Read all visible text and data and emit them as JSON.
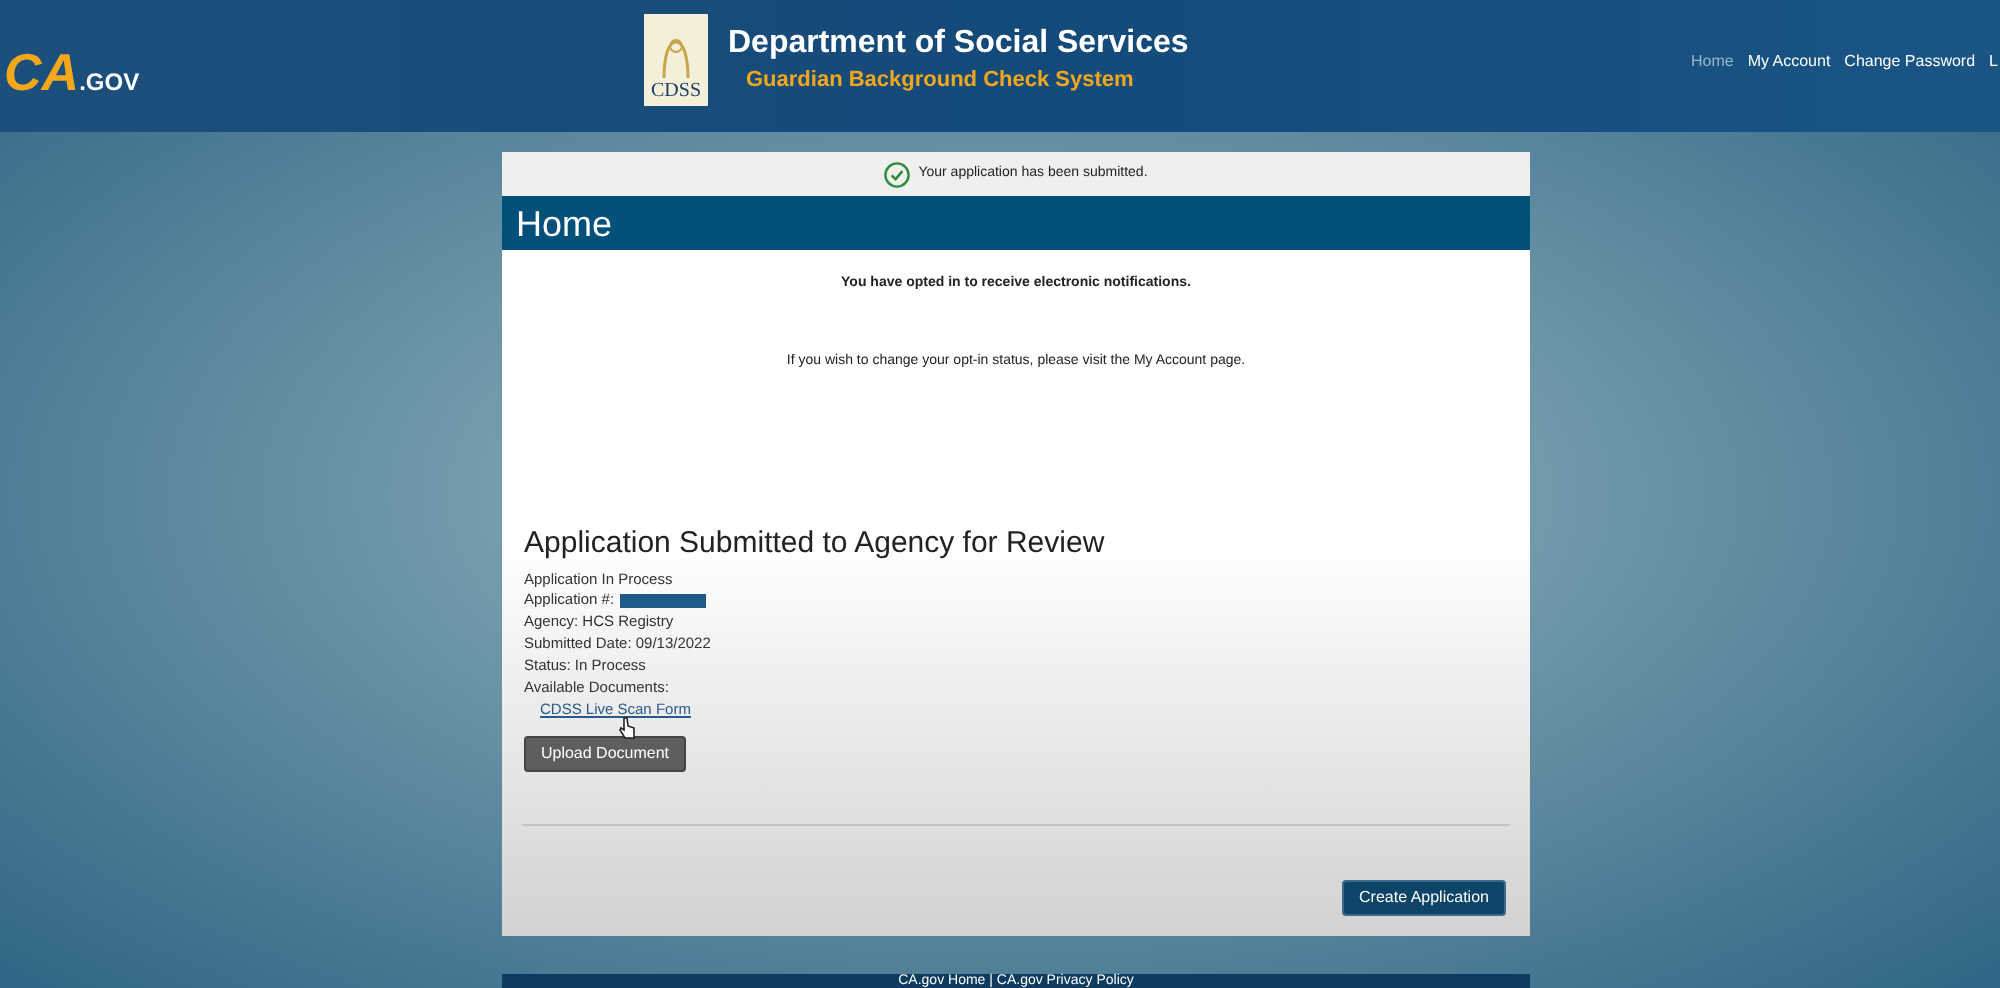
{
  "header": {
    "logo_text": "CA",
    "logo_suffix": ".GOV",
    "seal_text": "CDSS",
    "title": "Department of Social Services",
    "subtitle": "Guardian Background Check System",
    "nav": [
      {
        "label": "Home",
        "selected": true
      },
      {
        "label": "My Account",
        "selected": false
      },
      {
        "label": "Change Password",
        "selected": false
      },
      {
        "label": "L",
        "selected": false
      }
    ]
  },
  "alert": {
    "message": "Your application has been submitted."
  },
  "page_title": "Home",
  "notices": [
    "You have opted in to receive electronic notifications.",
    "If you wish to change your opt-in status, please visit the My Account page."
  ],
  "application": {
    "heading": "Application Submitted to Agency for Review",
    "lines": [
      {
        "kind": "text",
        "text": "Application In Process"
      },
      {
        "kind": "redacted",
        "text": "Application #:"
      },
      {
        "kind": "text",
        "text": "Agency: HCS Registry"
      },
      {
        "kind": "text",
        "text": "Submitted Date: 09/13/2022"
      },
      {
        "kind": "text",
        "text": "Status: In Process"
      },
      {
        "kind": "text",
        "text": "Available Documents:"
      }
    ],
    "documents": [
      "CDSS Live Scan Form"
    ],
    "upload_button": "Upload Document"
  },
  "create_button": "Create Application",
  "footer": {
    "links": [
      "CA.gov Home | CA.gov Privacy Policy"
    ]
  }
}
